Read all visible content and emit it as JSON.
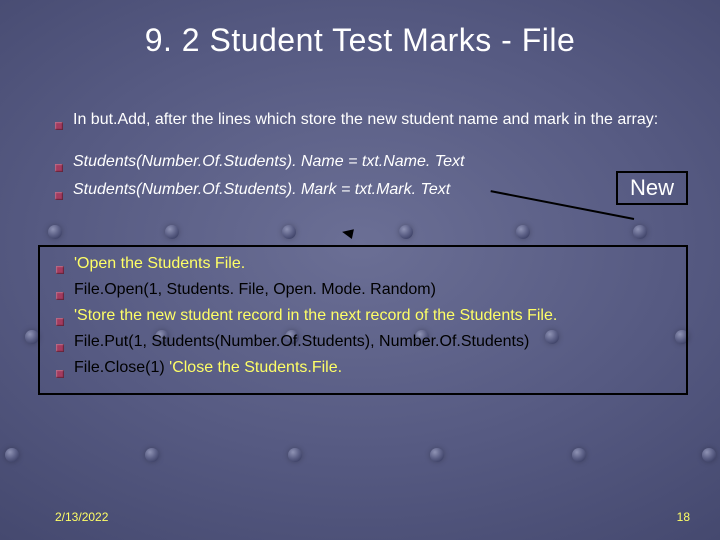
{
  "title": "9. 2 Student Test Marks - File",
  "intro": "In but.Add, after the lines which store the new student name and mark in the array:",
  "code_italics": {
    "line1": "Students(Number.Of.Students). Name = txt.Name. Text",
    "line2": "Students(Number.Of.Students). Mark = txt.Mark. Text"
  },
  "new_label": "New",
  "code_box": {
    "l1": "'Open the Students File.",
    "l2": "File.Open(1, Students. File, Open. Mode. Random)",
    "l3": "'Store the new student record in the next record of the Students File.",
    "l4": "File.Put(1, Students(Number.Of.Students), Number.Of.Students)",
    "l5a": "File.Close(1) ",
    "l5b": "'Close the Students.File."
  },
  "footer": {
    "date": "2/13/2022",
    "page": "18"
  }
}
